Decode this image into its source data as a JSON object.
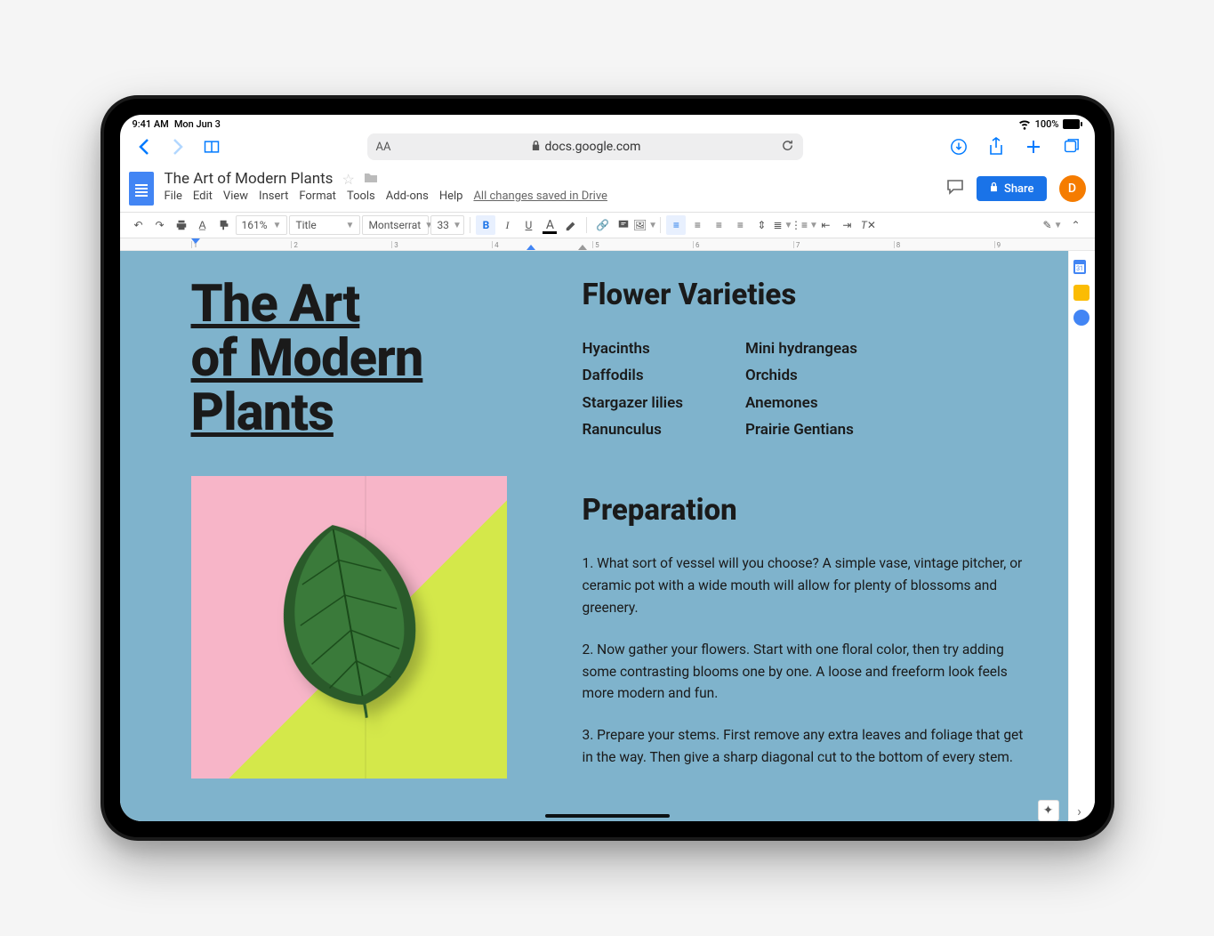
{
  "status": {
    "time": "9:41 AM",
    "date": "Mon Jun 3",
    "battery": "100%"
  },
  "safari": {
    "url_host": "docs.google.com"
  },
  "docs": {
    "title": "The Art of Modern Plants",
    "menus": [
      "File",
      "Edit",
      "View",
      "Insert",
      "Format",
      "Tools",
      "Add-ons",
      "Help"
    ],
    "save_status": "All changes saved in Drive",
    "share_label": "Share",
    "avatar_initial": "D"
  },
  "toolbar": {
    "zoom": "161%",
    "style": "Title",
    "font": "Montserrat",
    "size": "33"
  },
  "ruler": {
    "ticks": [
      "1",
      "2",
      "3",
      "4",
      "5",
      "6",
      "7",
      "8",
      "9"
    ]
  },
  "document": {
    "title_lines": [
      "The Art",
      "of Modern",
      "Plants"
    ],
    "section1_heading": "Flower Varieties",
    "varieties_col1": [
      "Hyacinths",
      "Daffodils",
      "Stargazer lilies",
      "Ranunculus"
    ],
    "varieties_col2": [
      "Mini hydrangeas",
      "Orchids",
      "Anemones",
      "Prairie Gentians"
    ],
    "section2_heading": "Preparation",
    "prep": [
      "1. What sort of vessel will you choose? A simple vase, vintage pitcher, or ceramic pot with a wide mouth will allow for plenty of blossoms and greenery.",
      "2. Now gather your flowers. Start with one floral color, then try adding some contrasting blooms one by one. A loose and freeform look feels more modern and fun.",
      "3. Prepare your stems. First remove any extra leaves and foliage that get in the way. Then give a sharp diagonal cut to the bottom of every stem."
    ]
  }
}
